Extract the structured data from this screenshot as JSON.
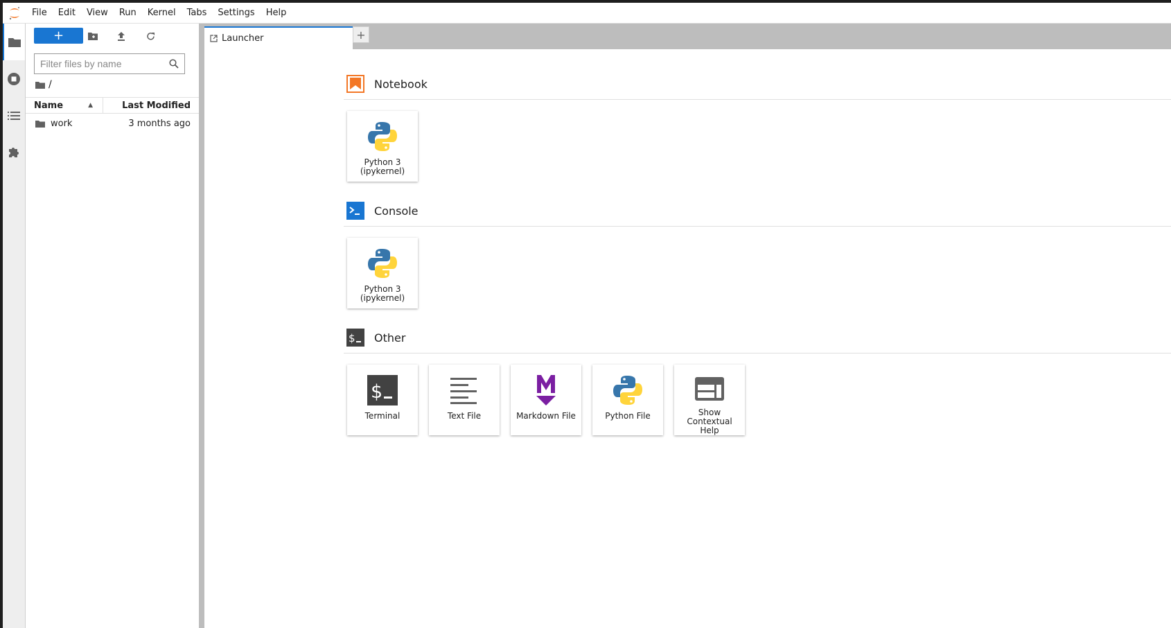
{
  "menu": [
    "File",
    "Edit",
    "View",
    "Run",
    "Kernel",
    "Tabs",
    "Settings",
    "Help"
  ],
  "filebrowser": {
    "new_label": "+",
    "filter_placeholder": "Filter files by name",
    "breadcrumb": "/",
    "columns": {
      "name": "Name",
      "modified": "Last Modified"
    },
    "files": [
      {
        "name": "work",
        "modified": "3 months ago",
        "type": "folder"
      }
    ]
  },
  "tabs": [
    {
      "label": "Launcher",
      "icon": "launcher-icon"
    }
  ],
  "add_tab_label": "+",
  "launcher": {
    "sections": [
      {
        "title": "Notebook",
        "icon": "notebook-icon",
        "color": "#f37726",
        "items": [
          {
            "label": "Python 3 (ipykernel)",
            "icon": "python-icon"
          }
        ]
      },
      {
        "title": "Console",
        "icon": "console-icon",
        "color": "#1976d2",
        "items": [
          {
            "label": "Python 3 (ipykernel)",
            "icon": "python-icon"
          }
        ]
      },
      {
        "title": "Other",
        "icon": "terminal-icon",
        "color": "#424242",
        "items": [
          {
            "label": "Terminal",
            "icon": "terminal-icon"
          },
          {
            "label": "Text File",
            "icon": "text-file-icon"
          },
          {
            "label": "Markdown File",
            "icon": "markdown-icon"
          },
          {
            "label": "Python File",
            "icon": "python-icon"
          },
          {
            "label": "Show Contextual Help",
            "icon": "contextual-help-icon"
          }
        ]
      }
    ]
  },
  "colors": {
    "accent": "#1976d2",
    "jupyter_orange": "#f37726",
    "markdown_purple": "#7b1fa2"
  }
}
